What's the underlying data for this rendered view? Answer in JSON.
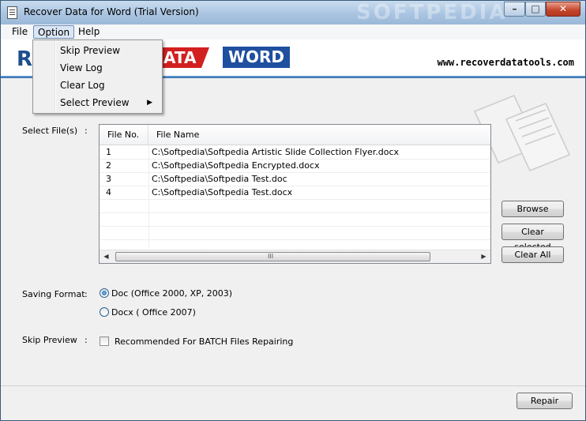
{
  "window": {
    "title": "Recover Data for Word (Trial Version)",
    "watermark": "SOFTPEDIA"
  },
  "menu": {
    "items": [
      "File",
      "Option",
      "Help"
    ],
    "active": "Option"
  },
  "dropdown": {
    "items": [
      "Skip Preview",
      "View Log",
      "Clear Log",
      "Select Preview"
    ]
  },
  "banner": {
    "logo_r": "R",
    "logo_data": "ATA",
    "logo_word": "WORD",
    "url": "www.recoverdatatools.com"
  },
  "files": {
    "label": "Select File(s)",
    "colon": ":",
    "columns": [
      "File No.",
      "File Name"
    ],
    "rows": [
      {
        "no": "1",
        "name": "C:\\Softpedia\\Softpedia Artistic Slide Collection Flyer.docx"
      },
      {
        "no": "2",
        "name": "C:\\Softpedia\\Softpedia Encrypted.docx"
      },
      {
        "no": "3",
        "name": "C:\\Softpedia\\Softpedia Test.doc"
      },
      {
        "no": "4",
        "name": "C:\\Softpedia\\Softpedia Test.docx"
      }
    ],
    "scroll_grip": "III"
  },
  "buttons": {
    "browse": "Browse",
    "clear_selected": "Clear selected",
    "clear_all": "Clear All",
    "repair": "Repair"
  },
  "saving_format": {
    "label": "Saving Format",
    "colon": ":",
    "options": [
      "Doc (Office 2000, XP, 2003)",
      "Docx ( Office 2007)"
    ],
    "selected_index": 0
  },
  "skip_preview": {
    "label": "Skip Preview",
    "colon": ":",
    "checkbox_label": "Recommended For BATCH Files Repairing",
    "checked": false
  }
}
